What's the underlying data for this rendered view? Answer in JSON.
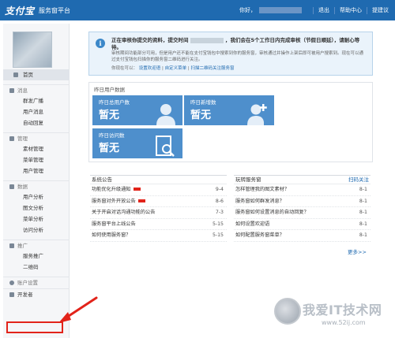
{
  "header": {
    "logo": "支付宝",
    "platform": "服务窗平台",
    "greeting": "你好，",
    "links": [
      "退出",
      "帮助中心",
      "提建议"
    ]
  },
  "sidebar": {
    "home": "首页",
    "groups": [
      {
        "label": "消息",
        "items": [
          "群发广播",
          "用户消息",
          "自动回复"
        ]
      },
      {
        "label": "管理",
        "items": [
          "素材管理",
          "菜单管理",
          "用户管理"
        ]
      },
      {
        "label": "数据",
        "items": [
          "用户分析",
          "图文分析",
          "菜单分析",
          "访问分析"
        ]
      },
      {
        "label": "推广",
        "items": [
          "服务推广",
          "二维码"
        ]
      }
    ],
    "account_settings": "账户设置",
    "developer": "开发者"
  },
  "notice": {
    "line1_pre": "正在审核你提交的资料，提交时间",
    "line1_post": "，我们会在5个工作日内完成审核（节假日顺延），请耐心等待。",
    "line2": "审核期间功能部分可用，但是用户还不能在支付宝钱包中搜索到你的服务窗，审核通过并操作上架后即可被用户搜索到。现在可以通过支付宝钱包扫描你的服务窗二维码进行关注。",
    "line3_pre": "你现在可以：",
    "links": [
      "设置欢迎语",
      "自定义菜单",
      "扫描二维码关注服务窗"
    ]
  },
  "stats": {
    "title": "昨日用户数据",
    "cards": [
      {
        "label": "昨日总用户数",
        "value": "暂无"
      },
      {
        "label": "昨日新增数",
        "value": "暂无"
      },
      {
        "label": "昨日访问数",
        "value": "暂无"
      }
    ]
  },
  "announcements": {
    "title": "系统公告",
    "rows": [
      {
        "text": "功能优化升级通知",
        "date": "9-4",
        "badge": true
      },
      {
        "text": "服务窗对外开放公告",
        "date": "8-6",
        "badge": true
      },
      {
        "text": "关于开启对话沟通功能的公告",
        "date": "7-3",
        "badge": false
      },
      {
        "text": "服务窗平台上线公告",
        "date": "5-15",
        "badge": false
      },
      {
        "text": "如何使用服务窗？",
        "date": "5-15",
        "badge": false
      }
    ]
  },
  "tips": {
    "title": "玩转服务窗",
    "action": "扫码关注",
    "rows": [
      {
        "text": "怎样管理我的图文素材？",
        "date": "8-1"
      },
      {
        "text": "服务窗如何群发消息？",
        "date": "8-1"
      },
      {
        "text": "服务窗如何设置消息的自动回复？",
        "date": "8-1"
      },
      {
        "text": "如何设置欢迎语",
        "date": "8-1"
      },
      {
        "text": "如何配置服务窗菜单？",
        "date": "8-1"
      }
    ],
    "more": "更多>>"
  },
  "watermark": {
    "text": "我爱IT技术网",
    "url": "www.52ij.com"
  },
  "colors": {
    "topbar": "#1f6ab0",
    "stat_tile": "#4e8fcc",
    "highlight": "#e2231a",
    "link": "#1f6ab0"
  }
}
